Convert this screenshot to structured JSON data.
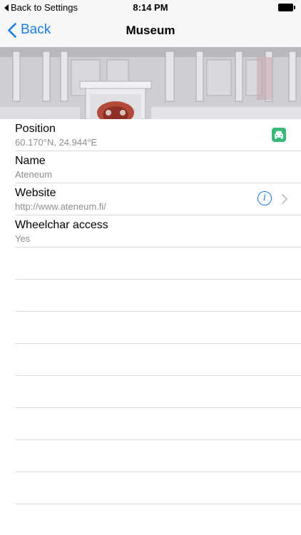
{
  "status_bar": {
    "back_label": "Back to Settings",
    "time": "8:14 PM"
  },
  "nav": {
    "back_label": "Back",
    "title": "Museum"
  },
  "details": {
    "position": {
      "label": "Position",
      "value": "60.170°N, 24.944°E",
      "action_icon": "car-icon"
    },
    "name": {
      "label": "Name",
      "value": "Ateneum"
    },
    "website": {
      "label": "Website",
      "value": "http://www.ateneum.fi/",
      "info_glyph": "i",
      "action_icon": "chevron-right-icon"
    },
    "wheelchair": {
      "label": "Wheelchar access",
      "value": "Yes"
    }
  },
  "colors": {
    "accent": "#1a7de0",
    "car_badge": "#39b87a",
    "secondary_text": "#8e8e93"
  }
}
